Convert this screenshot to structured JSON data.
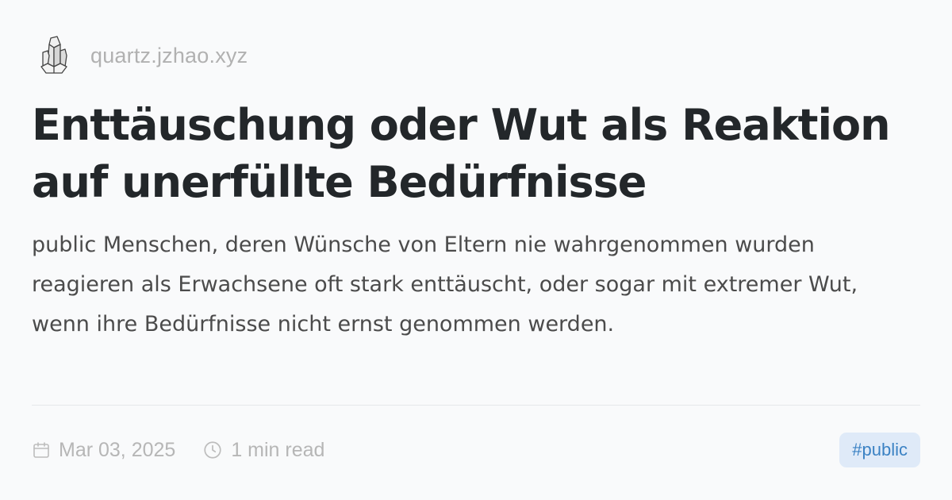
{
  "site": {
    "name": "quartz.jzhao.xyz",
    "logo_icon": "crystal-logo-icon"
  },
  "article": {
    "title": "Enttäuschung oder Wut als Reaktion auf unerfüllte Bedürfnisse",
    "description": "public Menschen, deren Wünsche von Eltern nie wahrgenommen wurden reagieren als Erwachsene oft stark enttäuscht, oder sogar mit extremer Wut, wenn ihre Bedürfnisse nicht ernst genommen werden."
  },
  "meta": {
    "date": "Mar 03, 2025",
    "date_icon": "calendar-icon",
    "read_time": "1 min read",
    "read_time_icon": "clock-icon"
  },
  "tags": [
    "#public"
  ],
  "colors": {
    "background": "#f9fafb",
    "title": "#23272a",
    "muted": "#b6b6b6",
    "tag_bg": "#dfeaf8",
    "tag_text": "#3b82c4"
  }
}
